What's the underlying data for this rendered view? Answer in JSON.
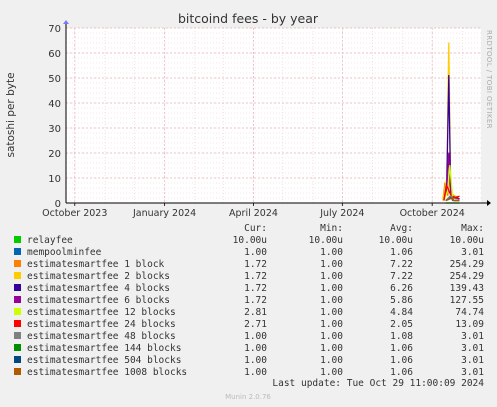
{
  "chart_data": {
    "type": "line",
    "title": "bitcoind fees - by year",
    "ylabel": "satoshi per byte",
    "xlabel": "",
    "ylim": [
      0,
      70
    ],
    "y_ticks": [
      0,
      10,
      20,
      30,
      40,
      50,
      60,
      70
    ],
    "x_range": [
      "2023-09-22",
      "2024-11-20"
    ],
    "x_ticks": [
      {
        "date": "2023-10-01",
        "label": "October 2023"
      },
      {
        "date": "2024-01-01",
        "label": "January 2024"
      },
      {
        "date": "2024-04-01",
        "label": "April 2024"
      },
      {
        "date": "2024-07-01",
        "label": "July 2024"
      },
      {
        "date": "2024-10-01",
        "label": "October 2024"
      }
    ],
    "grid": true,
    "series": [
      {
        "name": "relayfee",
        "color": "#00cc00",
        "cur": "10.00u",
        "min": "10.00u",
        "avg": "10.00u",
        "max": "10.00u",
        "points": [
          [
            "2024-10-15",
            0.0
          ],
          [
            "2024-10-29",
            0.0
          ]
        ]
      },
      {
        "name": "mempoolminfee",
        "color": "#0066b3",
        "cur": "1.00",
        "min": "1.00",
        "avg": "1.06",
        "max": "3.01",
        "points": [
          [
            "2024-10-15",
            1.0
          ],
          [
            "2024-10-20",
            2.5
          ],
          [
            "2024-10-22",
            1.0
          ],
          [
            "2024-10-29",
            1.0
          ]
        ]
      },
      {
        "name": "estimatesmartfee 1 block",
        "color": "#ff8000",
        "cur": "1.72",
        "min": "1.00",
        "avg": "7.22",
        "max": "254.29",
        "points": [
          [
            "2024-10-12",
            1.0
          ],
          [
            "2024-10-14",
            8.0
          ],
          [
            "2024-10-17",
            3.0
          ],
          [
            "2024-10-19",
            12.0
          ],
          [
            "2024-10-21",
            2.0
          ],
          [
            "2024-10-29",
            1.7
          ]
        ]
      },
      {
        "name": "estimatesmartfee 2 blocks",
        "color": "#ffcc00",
        "cur": "1.72",
        "min": "1.00",
        "avg": "7.22",
        "max": "254.29",
        "points": [
          [
            "2024-10-12",
            1.0
          ],
          [
            "2024-10-16",
            10.0
          ],
          [
            "2024-10-18",
            64.0
          ],
          [
            "2024-10-20",
            4.0
          ],
          [
            "2024-10-29",
            1.7
          ]
        ]
      },
      {
        "name": "estimatesmartfee 4 blocks",
        "color": "#330099",
        "cur": "1.72",
        "min": "1.00",
        "avg": "6.26",
        "max": "139.43",
        "points": [
          [
            "2024-10-13",
            1.0
          ],
          [
            "2024-10-16",
            8.0
          ],
          [
            "2024-10-18",
            51.0
          ],
          [
            "2024-10-20",
            3.0
          ],
          [
            "2024-10-29",
            1.7
          ]
        ]
      },
      {
        "name": "estimatesmartfee 6 blocks",
        "color": "#990099",
        "cur": "1.72",
        "min": "1.00",
        "avg": "5.86",
        "max": "127.55",
        "points": [
          [
            "2024-10-13",
            1.0
          ],
          [
            "2024-10-16",
            6.0
          ],
          [
            "2024-10-18",
            20.0
          ],
          [
            "2024-10-20",
            2.5
          ],
          [
            "2024-10-29",
            1.7
          ]
        ]
      },
      {
        "name": "estimatesmartfee 12 blocks",
        "color": "#ccff00",
        "cur": "2.81",
        "min": "1.00",
        "avg": "4.84",
        "max": "74.74",
        "points": [
          [
            "2024-10-13",
            1.0
          ],
          [
            "2024-10-17",
            5.0
          ],
          [
            "2024-10-19",
            15.0
          ],
          [
            "2024-10-22",
            2.0
          ],
          [
            "2024-10-29",
            2.8
          ]
        ]
      },
      {
        "name": "estimatesmartfee 24 blocks",
        "color": "#ff0000",
        "cur": "2.71",
        "min": "1.00",
        "avg": "2.05",
        "max": "13.09",
        "points": [
          [
            "2024-10-13",
            1.0
          ],
          [
            "2024-10-16",
            7.0
          ],
          [
            "2024-10-19",
            4.0
          ],
          [
            "2024-10-22",
            2.0
          ],
          [
            "2024-10-29",
            2.7
          ]
        ]
      },
      {
        "name": "estimatesmartfee 48 blocks",
        "color": "#808080",
        "cur": "1.00",
        "min": "1.00",
        "avg": "1.08",
        "max": "3.01",
        "points": [
          [
            "2024-10-15",
            1.0
          ],
          [
            "2024-10-20",
            3.0
          ],
          [
            "2024-10-23",
            1.0
          ],
          [
            "2024-10-29",
            1.0
          ]
        ]
      },
      {
        "name": "estimatesmartfee 144 blocks",
        "color": "#008f00",
        "cur": "1.00",
        "min": "1.00",
        "avg": "1.06",
        "max": "3.01",
        "points": [
          [
            "2024-10-15",
            1.0
          ],
          [
            "2024-10-21",
            2.0
          ],
          [
            "2024-10-23",
            1.0
          ],
          [
            "2024-10-29",
            1.0
          ]
        ]
      },
      {
        "name": "estimatesmartfee 504 blocks",
        "color": "#00487d",
        "cur": "1.00",
        "min": "1.00",
        "avg": "1.06",
        "max": "3.01",
        "points": [
          [
            "2024-10-15",
            1.0
          ],
          [
            "2024-10-21",
            2.0
          ],
          [
            "2024-10-23",
            1.0
          ],
          [
            "2024-10-29",
            1.0
          ]
        ]
      },
      {
        "name": "estimatesmartfee 1008 blocks",
        "color": "#b35a00",
        "cur": "1.00",
        "min": "1.00",
        "avg": "1.06",
        "max": "3.01",
        "points": [
          [
            "2024-10-15",
            1.0
          ],
          [
            "2024-10-21",
            2.0
          ],
          [
            "2024-10-23",
            1.0
          ],
          [
            "2024-10-29",
            1.0
          ]
        ]
      }
    ]
  },
  "legend_headers": {
    "cur": "Cur:",
    "min": "Min:",
    "avg": "Avg:",
    "max": "Max:"
  },
  "last_update": "Last update: Tue Oct 29 11:00:09 2024",
  "watermark": "RRDTOOL / TOBI OETIKER",
  "footer": "Munin 2.0.76",
  "colors": {
    "background": "#f0f0f0",
    "plot_background": "#ffffff",
    "grid": "#e8b4b4",
    "axis": "#000000"
  }
}
